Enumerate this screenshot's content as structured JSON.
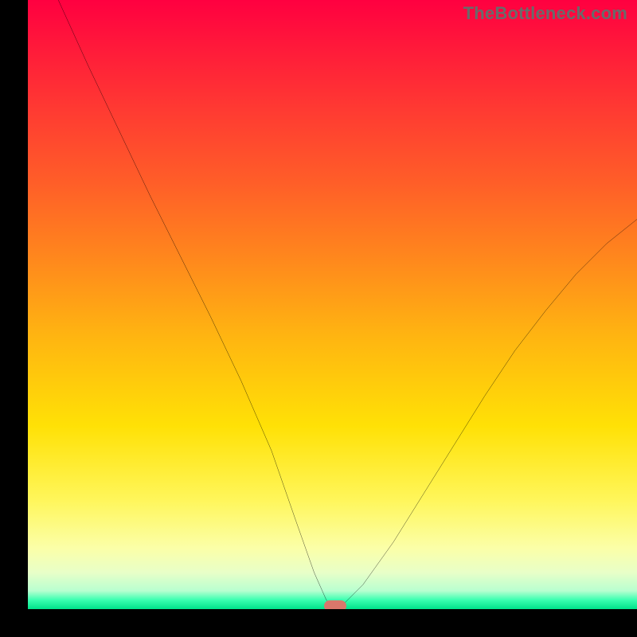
{
  "watermark": "TheBottleneck.com",
  "colors": {
    "background": "#000000",
    "curve": "#000000",
    "marker": "#d9776b",
    "watermark_text": "#6a6a6a",
    "gradient_top": "#ff0040",
    "gradient_bottom": "#00e28a"
  },
  "chart_data": {
    "type": "line",
    "title": "",
    "xlabel": "",
    "ylabel": "",
    "xlim": [
      0,
      100
    ],
    "ylim": [
      0,
      100
    ],
    "grid": false,
    "legend": false,
    "series": [
      {
        "name": "bottleneck-curve",
        "x": [
          5,
          10,
          15,
          20,
          25,
          30,
          35,
          40,
          44,
          47,
          49,
          50,
          51,
          52,
          55,
          60,
          65,
          70,
          75,
          80,
          85,
          90,
          95,
          100
        ],
        "y": [
          100,
          89,
          78.5,
          68,
          58,
          48,
          37.5,
          26,
          14.5,
          6,
          1.5,
          0.5,
          0.5,
          1,
          4,
          11,
          19,
          27,
          35,
          42.5,
          49,
          55,
          60,
          64
        ]
      }
    ],
    "annotations": [
      {
        "name": "optimal-marker",
        "x": 50.5,
        "y": 0.5
      }
    ],
    "background_gradient": {
      "orientation": "vertical",
      "stops": [
        {
          "pos": 0.0,
          "color": "#ff0040"
        },
        {
          "pos": 0.3,
          "color": "#ff5e28"
        },
        {
          "pos": 0.55,
          "color": "#ffb411"
        },
        {
          "pos": 0.82,
          "color": "#fff65a"
        },
        {
          "pos": 0.94,
          "color": "#e8ffc8"
        },
        {
          "pos": 1.0,
          "color": "#00e28a"
        }
      ]
    }
  }
}
